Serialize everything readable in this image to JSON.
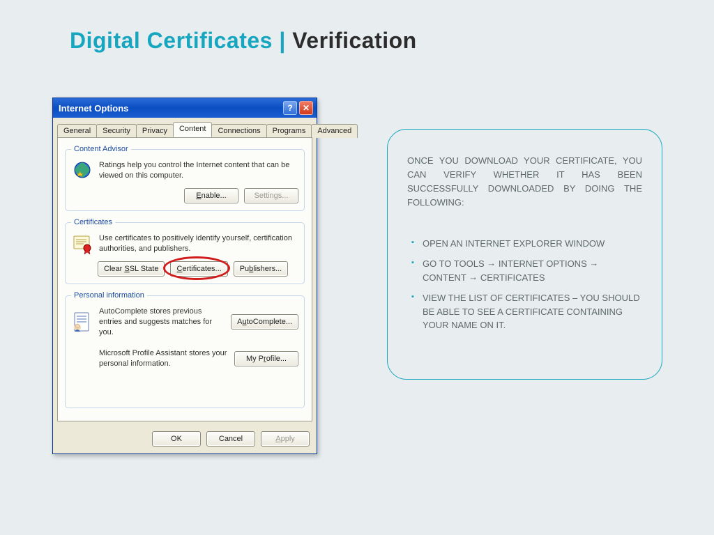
{
  "title": {
    "part1": "Digital Certificates ",
    "sep": "| ",
    "part2": "Verification"
  },
  "dialog": {
    "title": "Internet Options",
    "help": "?",
    "close": "✕",
    "tabs": [
      "General",
      "Security",
      "Privacy",
      "Content",
      "Connections",
      "Programs",
      "Advanced"
    ],
    "active_tab_index": 3,
    "groups": {
      "content_advisor": {
        "legend": "Content Advisor",
        "text": "Ratings help you control the Internet content that can be viewed on this computer.",
        "enable": "Enable...",
        "settings": "Settings..."
      },
      "certificates": {
        "legend": "Certificates",
        "text": "Use certificates to positively identify yourself, certification authorities, and publishers.",
        "clear_ssl": "Clear SSL State",
        "certificates": "Certificates...",
        "publishers": "Publishers..."
      },
      "personal": {
        "legend": "Personal information",
        "auto_text": "AutoComplete stores previous entries and suggests matches for you.",
        "auto_btn": "AutoComplete...",
        "profile_text": "Microsoft Profile Assistant stores your personal information.",
        "profile_btn": "My Profile..."
      }
    },
    "footer": {
      "ok": "OK",
      "cancel": "Cancel",
      "apply": "Apply"
    }
  },
  "callout": {
    "intro": "Once you download your certificate, you can verify whether it has been successfully downloaded by doing the following:",
    "items": [
      "Open an Internet Explorer window",
      "Go to Tools → Internet Options → Content → Certificates",
      "View the list of certificates – you should be able to see a certificate containing your name on it."
    ]
  }
}
